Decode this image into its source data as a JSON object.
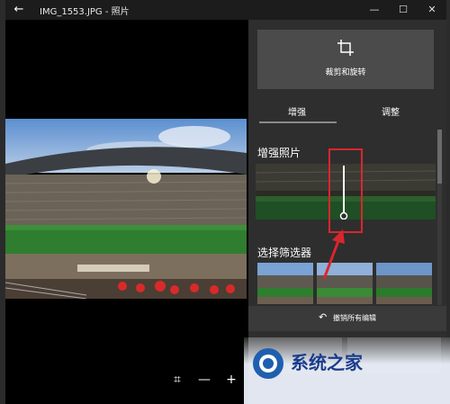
{
  "window": {
    "title": "IMG_1553.JPG - 照片",
    "back_icon": "←",
    "minimize_icon": "—",
    "maximize_icon": "☐",
    "close_icon": "✕"
  },
  "viewer": {
    "fit_icon": "⌗",
    "zoom_out_icon": "—",
    "zoom_in_icon": "+"
  },
  "panel": {
    "crop_label": "裁剪和旋转",
    "tabs": [
      {
        "label": "增强"
      },
      {
        "label": "调整"
      }
    ],
    "enhance_label": "增强照片",
    "filter_label": "选择筛选器",
    "undo_label": "撤销所有编辑",
    "undo_icon": "↶",
    "enhance_level": 0.0
  },
  "colors": {
    "accent_annotation": "#d9262e",
    "panel_bg": "#2e2e2e"
  },
  "watermark": {
    "text": "系统之家"
  }
}
